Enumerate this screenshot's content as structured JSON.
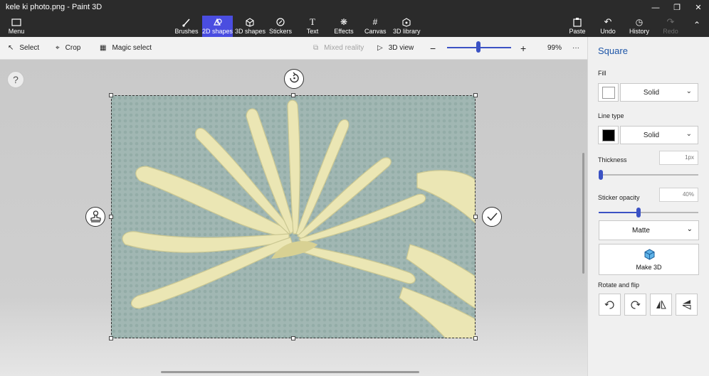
{
  "window": {
    "title": "kele ki photo.png - Paint 3D",
    "controls": [
      "minimize",
      "restore",
      "close"
    ]
  },
  "ribbon": {
    "menu_label": "Menu",
    "tools": [
      {
        "label": "Brushes",
        "icon": "brush-icon"
      },
      {
        "label": "2D shapes",
        "icon": "shapes-2d-icon",
        "active": true
      },
      {
        "label": "3D shapes",
        "icon": "cube-icon"
      },
      {
        "label": "Stickers",
        "icon": "sticker-icon"
      },
      {
        "label": "Text",
        "icon": "text-icon"
      },
      {
        "label": "Effects",
        "icon": "effects-icon"
      },
      {
        "label": "Canvas",
        "icon": "canvas-icon"
      },
      {
        "label": "3D library",
        "icon": "library-icon"
      }
    ],
    "right": [
      {
        "label": "Paste",
        "icon": "paste-icon"
      },
      {
        "label": "Undo",
        "icon": "undo-icon"
      },
      {
        "label": "History",
        "icon": "history-icon"
      },
      {
        "label": "Redo",
        "icon": "redo-icon",
        "disabled": true
      }
    ]
  },
  "toolbar": {
    "select": "Select",
    "crop": "Crop",
    "magic_select": "Magic select",
    "mixed_reality": "Mixed reality",
    "view_3d": "3D view",
    "zoom_level": "99%",
    "zoom_value_percent": 99,
    "more": "···"
  },
  "canvas": {
    "help": "?",
    "accent": "#3b52c4"
  },
  "panel": {
    "title": "Square",
    "fill_label": "Fill",
    "fill_style": "Solid",
    "fill_color": "#ffffff",
    "line_type_label": "Line type",
    "line_style": "Solid",
    "line_color": "#000000",
    "thickness_label": "Thickness",
    "thickness_value": "1px",
    "thickness_fraction": 0.02,
    "opacity_label": "Sticker opacity",
    "opacity_value": "40%",
    "opacity_fraction": 0.4,
    "finish": "Matte",
    "make3d": "Make 3D",
    "rotate_label": "Rotate and flip",
    "rotate_buttons": [
      "rotate-left-icon",
      "rotate-right-icon",
      "flip-vertical-icon",
      "flip-horizontal-icon"
    ]
  }
}
